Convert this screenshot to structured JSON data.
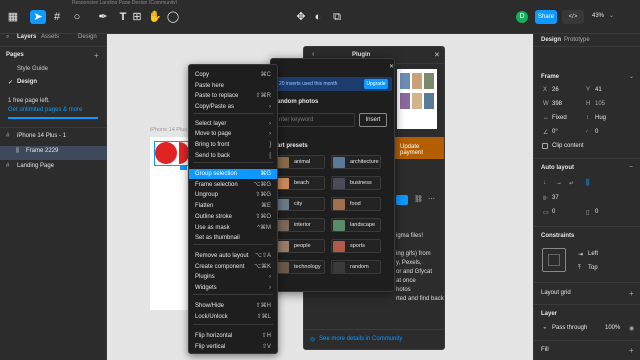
{
  "topbar": {
    "tab_text": "Responsive Landing Page Design (Community)",
    "avatar_letter": "D",
    "share_label": "Share",
    "zoom": "43%"
  },
  "left_panel": {
    "tabs": [
      "Layers",
      "Assets"
    ],
    "design_label": "Design",
    "pages_label": "Pages",
    "pages": [
      "Style Guide",
      "Design"
    ],
    "free_plan_line1": "1 free page left.",
    "free_plan_line2": "Get unlimited pages & more",
    "layers": [
      "iPhone 14 Plus - 1",
      "Frame 2229",
      "Landing Page"
    ]
  },
  "canvas": {
    "frame_label": "iPhone 14 Plus"
  },
  "context_menu": {
    "items": [
      {
        "label": "Copy",
        "shortcut": "⌘C"
      },
      {
        "label": "Paste here",
        "shortcut": ""
      },
      {
        "label": "Paste to replace",
        "shortcut": "⇧⌘R"
      },
      {
        "label": "Copy/Paste as",
        "shortcut": "›"
      },
      {
        "label": "Select layer",
        "shortcut": "›"
      },
      {
        "label": "Move to page",
        "shortcut": "›"
      },
      {
        "label": "Bring to front",
        "shortcut": "]"
      },
      {
        "label": "Send to back",
        "shortcut": "["
      },
      {
        "label": "Group selection",
        "shortcut": "⌘G"
      },
      {
        "label": "Frame selection",
        "shortcut": "⌥⌘G"
      },
      {
        "label": "Ungroup",
        "shortcut": "⇧⌘G"
      },
      {
        "label": "Flatten",
        "shortcut": "⌘E"
      },
      {
        "label": "Outline stroke",
        "shortcut": "⇧⌘O"
      },
      {
        "label": "Use as mask",
        "shortcut": "^⌘M"
      },
      {
        "label": "Set as thumbnail",
        "shortcut": ""
      },
      {
        "label": "Remove auto layout",
        "shortcut": "⌥⇧A"
      },
      {
        "label": "Create component",
        "shortcut": "⌥⌘K"
      },
      {
        "label": "Plugins",
        "shortcut": "›"
      },
      {
        "label": "Widgets",
        "shortcut": "›"
      },
      {
        "label": "Show/Hide",
        "shortcut": "⇧⌘H"
      },
      {
        "label": "Lock/Unlock",
        "shortcut": "⇧⌘L"
      },
      {
        "label": "Flip horizontal",
        "shortcut": "⇧H"
      },
      {
        "label": "Flip vertical",
        "shortcut": "⇧V"
      }
    ]
  },
  "plugin_window": {
    "title": "Plugin",
    "update_payment": "Update payment",
    "text_lines": [
      "igma files!",
      "ing gifs) from",
      "y, Pexels,",
      "or and Gfycat",
      "at once",
      "hotos",
      "rted and find back"
    ],
    "footer_link": "See more details in Community"
  },
  "unsplash_panel": {
    "banner_text": "20 inserts used this month",
    "upgrade_label": "Upgrade",
    "random_photos_label": "andom photos",
    "keyword_placeholder": "nter keyword",
    "insert_label": "Insert",
    "presets_label": "art presets",
    "presets": [
      "animal",
      "architecture",
      "beach",
      "business",
      "city",
      "food",
      "interior",
      "landscape",
      "people",
      "sports",
      "technology",
      "random"
    ]
  },
  "right_panel": {
    "tabs": [
      "Design",
      "Prototype"
    ],
    "frame_label": "Frame",
    "x": "26",
    "y": "41",
    "w": "398",
    "h": "105",
    "w_mode": "Fixed",
    "h_mode": "Hug",
    "rotation": "0°",
    "radius": "0",
    "clip_content": "Clip content",
    "auto_layout_label": "Auto layout",
    "gap": "37",
    "padding": "0",
    "constraints_label": "Constraints",
    "constraint_h": "Left",
    "constraint_v": "Top",
    "layout_grid_label": "Layout grid",
    "layer_label": "Layer",
    "blend_mode": "Pass through",
    "opacity": "100%",
    "fill_label": "Fill"
  }
}
